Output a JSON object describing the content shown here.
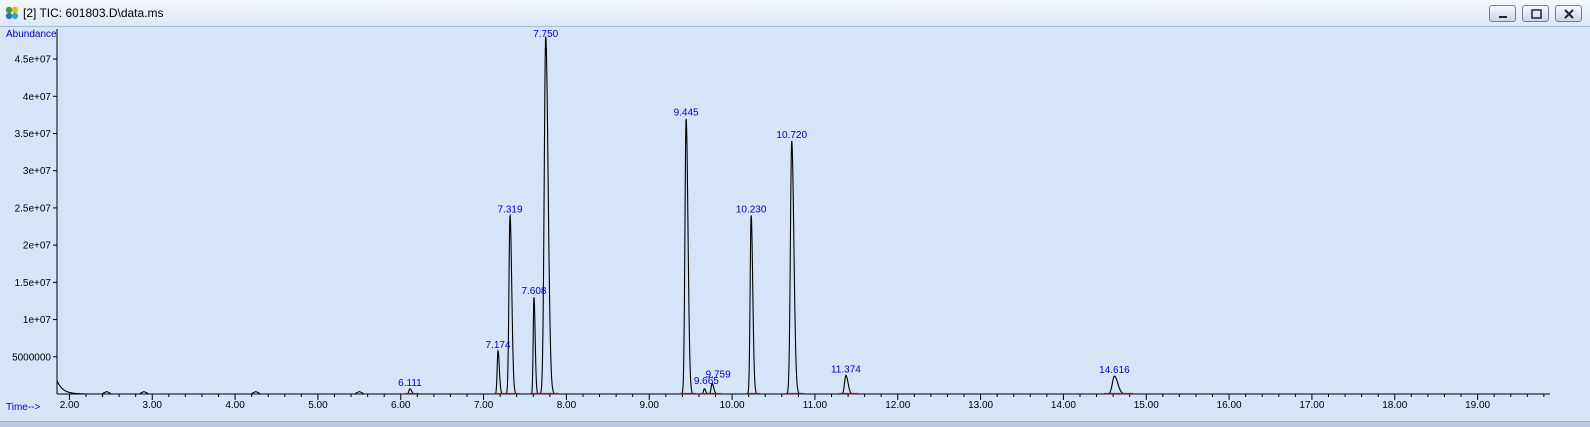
{
  "window": {
    "title": "[2] TIC: 601803.D\\data.ms",
    "minimize_icon": "minimize-icon",
    "restore_icon": "restore-icon",
    "close_icon": "close-icon",
    "app_icon": "chemstation-icon"
  },
  "colors": {
    "plot_background": "#d6e4f8",
    "trace": "#000000",
    "peak_label": "#0000cc",
    "axis_label": "#0000cc",
    "baseline_marker": "#e00000"
  },
  "chart_data": {
    "type": "line",
    "ylabel": "Abundance",
    "xlabel": "Time-->",
    "xlim": [
      1.85,
      19.85
    ],
    "ylim": [
      0,
      48500000
    ],
    "x_ticks": [
      "2.00",
      "3.00",
      "4.00",
      "5.00",
      "6.00",
      "7.00",
      "8.00",
      "9.00",
      "10.00",
      "11.00",
      "12.00",
      "13.00",
      "14.00",
      "15.00",
      "16.00",
      "17.00",
      "18.00",
      "19.00"
    ],
    "y_ticks": [
      "5000000",
      "1e+07",
      "1.5e+07",
      "2e+07",
      "2.5e+07",
      "3e+07",
      "3.5e+07",
      "4e+07",
      "4.5e+07"
    ],
    "y_tick_values": [
      5000000,
      10000000,
      15000000,
      20000000,
      25000000,
      30000000,
      35000000,
      40000000,
      45000000
    ],
    "grid": false,
    "peaks": [
      {
        "rt": 6.111,
        "label": "6.111",
        "height": 700000,
        "width": 0.012
      },
      {
        "rt": 7.174,
        "label": "7.174",
        "height": 5800000,
        "width": 0.01
      },
      {
        "rt": 7.319,
        "label": "7.319",
        "height": 24000000,
        "width": 0.013
      },
      {
        "rt": 7.608,
        "label": "7.608",
        "height": 13000000,
        "width": 0.009
      },
      {
        "rt": 7.75,
        "label": "7.750",
        "height": 48000000,
        "width": 0.018
      },
      {
        "rt": 9.445,
        "label": "9.445",
        "height": 37000000,
        "width": 0.014
      },
      {
        "rt": 9.665,
        "label": "9.665",
        "height": 700000,
        "width": 0.01
      },
      {
        "rt": 9.759,
        "label": "9.759",
        "height": 1400000,
        "width": 0.012
      },
      {
        "rt": 10.23,
        "label": "10.230",
        "height": 24000000,
        "width": 0.012
      },
      {
        "rt": 10.72,
        "label": "10.720",
        "height": 34000000,
        "width": 0.016
      },
      {
        "rt": 11.374,
        "label": "11.374",
        "height": 2500000,
        "width": 0.016
      },
      {
        "rt": 14.616,
        "label": "14.616",
        "height": 2400000,
        "width": 0.025
      }
    ]
  }
}
